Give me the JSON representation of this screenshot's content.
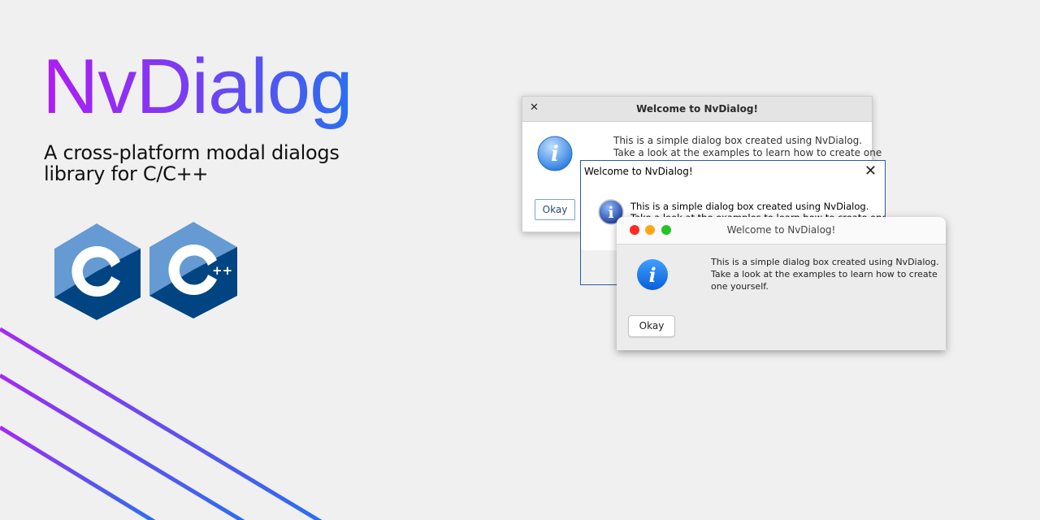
{
  "hero": {
    "title": "NvDialog",
    "subtitle": "A cross-platform modal dialogs library for C/C++"
  },
  "logos": [
    {
      "name": "c-logo",
      "letter": "C"
    },
    {
      "name": "cpp-logo",
      "letter": "C",
      "suffix": "++"
    }
  ],
  "colors": {
    "accent_start": "#b01cf4",
    "accent_end": "#2a6ff0",
    "logo_light": "#659ad2",
    "logo_dark": "#00599c",
    "mac_close": "#fe2a24",
    "mac_minimize": "#fea616",
    "mac_zoom": "#22c421"
  },
  "dialogs": {
    "gtk": {
      "title": "Welcome to NvDialog!",
      "close_symbol": "✕",
      "line1": "This is a simple dialog box created using NvDialog.",
      "line2": "Take a look at the examples to learn how to create one",
      "button": "Okay",
      "icon": "info-icon"
    },
    "win": {
      "title": "Welcome to NvDialog!",
      "close_symbol": "✕",
      "line1": "This is a simple dialog box created using NvDialog.",
      "line2": "Take a look at the examples to learn how to create one",
      "icon": "info-icon"
    },
    "mac": {
      "title": "Welcome to NvDialog!",
      "message": "This is a simple dialog box created using NvDialog. Take a look at the examples to learn how to create one yourself.",
      "button": "Okay",
      "icon": "info-icon"
    }
  }
}
